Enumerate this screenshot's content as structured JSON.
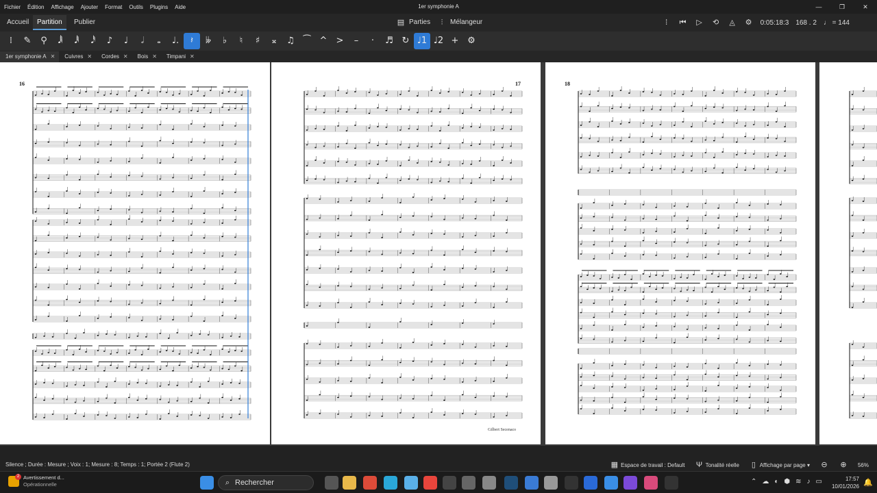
{
  "app": {
    "window_title": "1er symphonie A",
    "menus": [
      "Fichier",
      "Édition",
      "Affichage",
      "Ajouter",
      "Format",
      "Outils",
      "Plugins",
      "Aide"
    ]
  },
  "nav": {
    "tabs": [
      "Accueil",
      "Partition",
      "Publier"
    ],
    "active_tab": "Partition",
    "parts_label": "Parties",
    "mixer_label": "Mélangeur",
    "time": "0:05:18:3",
    "position": "168 . 2",
    "tempo": "♩ = 144"
  },
  "toolbar": {
    "buttons": [
      {
        "name": "toolbar-grip-icon",
        "glyph": "⁞"
      },
      {
        "name": "pen-icon",
        "glyph": "✎"
      },
      {
        "name": "pin-icon",
        "glyph": "⚲"
      },
      {
        "name": "sixtyfourth-note-icon",
        "glyph": "𝅘𝅥𝅲"
      },
      {
        "name": "thirtysecond-note-icon",
        "glyph": "𝅘𝅥𝅱"
      },
      {
        "name": "sixteenth-note-icon",
        "glyph": "𝅘𝅥𝅰"
      },
      {
        "name": "eighth-note-icon",
        "glyph": "♪"
      },
      {
        "name": "quarter-note-icon",
        "glyph": "♩"
      },
      {
        "name": "half-note-icon",
        "glyph": "𝅗𝅥"
      },
      {
        "name": "whole-note-icon",
        "glyph": "𝅝"
      },
      {
        "name": "dot-icon",
        "glyph": "♩."
      },
      {
        "name": "rest-icon",
        "glyph": "𝄽",
        "on": true
      },
      {
        "name": "double-flat-icon",
        "glyph": "𝄫"
      },
      {
        "name": "flat-icon",
        "glyph": "♭"
      },
      {
        "name": "natural-icon",
        "glyph": "♮"
      },
      {
        "name": "sharp-icon",
        "glyph": "♯"
      },
      {
        "name": "double-sharp-icon",
        "glyph": "𝄪"
      },
      {
        "name": "tie-icon",
        "glyph": "♫"
      },
      {
        "name": "slur-icon",
        "glyph": "⁀"
      },
      {
        "name": "marcato-icon",
        "glyph": "^"
      },
      {
        "name": "accent-icon",
        "glyph": ">"
      },
      {
        "name": "tenuto-icon",
        "glyph": "–"
      },
      {
        "name": "staccato-icon",
        "glyph": "·"
      },
      {
        "name": "tuplet-icon",
        "glyph": "♬"
      },
      {
        "name": "flip-icon",
        "glyph": "↻"
      },
      {
        "name": "voice-1-icon",
        "glyph": "♩1",
        "on": true
      },
      {
        "name": "voice-2-icon",
        "glyph": "♩2"
      },
      {
        "name": "add-icon",
        "glyph": "+"
      },
      {
        "name": "customize-icon",
        "glyph": "⚙"
      }
    ]
  },
  "doc_tabs": [
    "1er symphonie A",
    "Cuivres",
    "Cordes",
    "Bois",
    "Timpani"
  ],
  "score": {
    "page_numbers": [
      "16",
      "17",
      "18"
    ],
    "composer": "Gilbert Secenaco"
  },
  "statusbar": {
    "selection": "Silence ; Durée : Mesure ; Voix : 1; Mesure : 8; Temps : 1; Portée 2 (Flute 2)",
    "workspace": "Espace de travail : Default",
    "concert_pitch": "Tonalité réelle",
    "view_mode": "Affichage par page",
    "zoom": "56%"
  },
  "taskbar": {
    "notif_title": "Avertissement d...",
    "notif_sub": "Opérationnelle",
    "notif_count": "2",
    "search_placeholder": "Rechercher",
    "time": "17:57",
    "date": "10/01/2026"
  }
}
